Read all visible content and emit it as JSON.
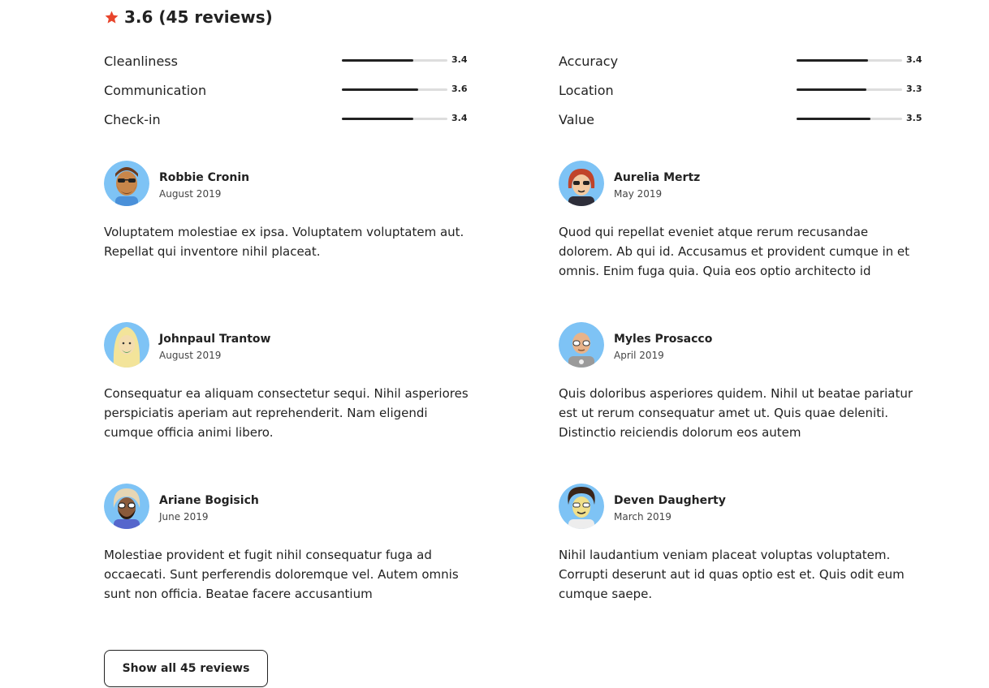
{
  "summary": {
    "text": "3.6 (45 reviews)",
    "star_color": "#E8452C"
  },
  "ratings": [
    {
      "label": "Cleanliness",
      "value": "3.4",
      "fraction": 0.68
    },
    {
      "label": "Accuracy",
      "value": "3.4",
      "fraction": 0.68
    },
    {
      "label": "Communication",
      "value": "3.6",
      "fraction": 0.72
    },
    {
      "label": "Location",
      "value": "3.3",
      "fraction": 0.66
    },
    {
      "label": "Check-in",
      "value": "3.4",
      "fraction": 0.68
    },
    {
      "label": "Value",
      "value": "3.5",
      "fraction": 0.7
    }
  ],
  "reviews": [
    {
      "name": "Robbie Cronin",
      "date": "August 2019",
      "text": "Voluptatem molestiae ex ipsa. Voluptatem voluptatem aut. Repellat qui inventore nihil placeat."
    },
    {
      "name": "Aurelia Mertz",
      "date": "May 2019",
      "text": "Quod qui repellat eveniet atque rerum recusandae dolorem. Ab qui id. Accusamus et provident cumque in et omnis. Enim fuga quia. Quia eos optio architecto id"
    },
    {
      "name": "Johnpaul Trantow",
      "date": "August 2019",
      "text": "Consequatur ea aliquam consectetur sequi. Nihil asperiores perspiciatis aperiam aut reprehenderit. Nam eligendi cumque officia animi libero."
    },
    {
      "name": "Myles Prosacco",
      "date": "April 2019",
      "text": "Quis doloribus asperiores quidem. Nihil ut beatae pariatur est ut rerum consequatur amet ut. Quis quae deleniti. Distinctio reiciendis dolorum eos autem"
    },
    {
      "name": "Ariane Bogisich",
      "date": "June 2019",
      "text": "Molestiae provident et fugit nihil consequatur fuga ad occaecati. Sunt perferendis doloremque vel. Autem omnis sunt non officia. Beatae facere accusantium"
    },
    {
      "name": "Deven Daugherty",
      "date": "March 2019",
      "text": "Nihil laudantium veniam placeat voluptas voluptatem. Corrupti deserunt aut id quas optio est et. Quis odit eum cumque saepe."
    }
  ],
  "show_all": {
    "label": "Show all 45 reviews"
  }
}
